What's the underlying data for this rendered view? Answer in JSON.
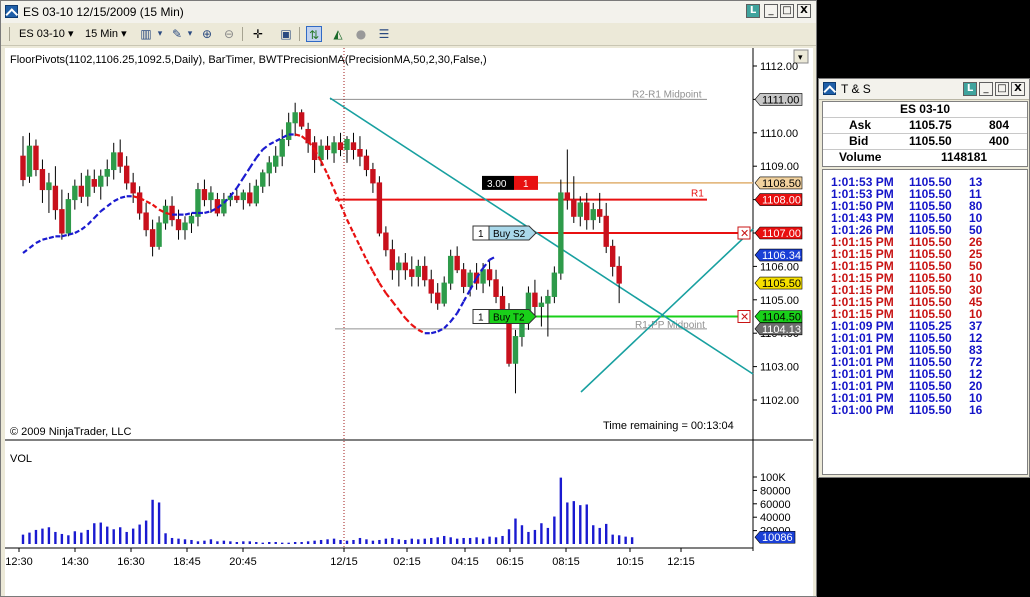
{
  "chart_window": {
    "title": "ES 03-10  12/15/2009 (15 Min)",
    "buttons": {
      "link": "L",
      "minimize": "_",
      "maximize": "□",
      "close": "X"
    },
    "toolbar": {
      "instrument": "ES 03-10",
      "interval": "15 Min"
    },
    "indicator_label": "FloorPivots(1102,1106.25,1092.5,Daily), BarTimer, BWTPrecisionMA(PrecisionMA,50,2,30,False,)",
    "copyright": "© 2009 NinjaTrader, LLC",
    "time_remaining": "Time remaining = 00:13:04",
    "volume_label": "VOL"
  },
  "chart_data": {
    "type": "candlestick",
    "price_axis": {
      "ylim": [
        1101.6,
        1112.2
      ],
      "ticks": [
        "1112.00",
        "1111.00",
        "1110.00",
        "1109.00",
        "1108.00",
        "1107.00",
        "1106.00",
        "1105.00",
        "1104.00",
        "1103.00",
        "1102.00"
      ]
    },
    "volume_axis": {
      "ylim": [
        0,
        100000
      ],
      "ticks": [
        "100K",
        "80000",
        "60000",
        "40000",
        "20000"
      ],
      "current": "10086"
    },
    "x_tick_labels": [
      "12:30",
      "14:30",
      "16:30",
      "18:45",
      "20:45",
      "12/15",
      "02:15",
      "04:15",
      "06:15",
      "08:15",
      "10:15",
      "12:15"
    ],
    "price_labels": [
      {
        "text": "1111.00",
        "price": 1111.0,
        "bg": "#c8c8c8",
        "fg": "#000000"
      },
      {
        "text": "1110.00",
        "price": 1110.0,
        "bg": "#ffffff",
        "fg": "#000000"
      },
      {
        "text": "1108.50",
        "price": 1108.5,
        "bg": "#f2d29e",
        "fg": "#000000"
      },
      {
        "text": "1108.00",
        "price": 1108.0,
        "bg": "#e81010",
        "fg": "#ffffff"
      },
      {
        "text": "1107.00",
        "price": 1107.0,
        "bg": "#e81010",
        "fg": "#ffffff"
      },
      {
        "text": "1106.34",
        "price": 1106.34,
        "bg": "#1a3fd6",
        "fg": "#ffffff"
      },
      {
        "text": "1105.50",
        "price": 1105.5,
        "bg": "#f6e000",
        "fg": "#000000"
      },
      {
        "text": "1104.50",
        "price": 1104.5,
        "bg": "#19d019",
        "fg": "#000000"
      },
      {
        "text": "1104.13",
        "price": 1104.13,
        "bg": "#6e6e6e",
        "fg": "#ffffff"
      }
    ],
    "levels": [
      {
        "name": "R2-R1 Midpoint",
        "price": 1111.0,
        "color": "#909090"
      },
      {
        "name": "R1",
        "price": 1108.0,
        "color": "#e81010"
      },
      {
        "name": "R1-PP Midpoint",
        "price": 1104.13,
        "color": "#909090"
      }
    ],
    "orders": [
      {
        "qty": "1",
        "label": "Buy S2",
        "price": 1107.0,
        "color": "#e81010"
      },
      {
        "qty": "1",
        "label": "Buy T2",
        "price": 1104.5,
        "color": "#19d019"
      },
      {
        "qty": "3.00",
        "label": "1",
        "price": 1108.5,
        "color": "#e0b070"
      }
    ],
    "colors": {
      "up_bar": "#2e9b4a",
      "down_bar": "#c8101c",
      "ma_up": "#1a1ad0",
      "ma_down": "#e81010",
      "trendline": "#18a0a0",
      "session_break": "#a01818",
      "volume": "#1a1ad0"
    },
    "bars": [
      [
        1109.3,
        1109.9,
        1108.4,
        1108.6
      ],
      [
        1108.7,
        1110.0,
        1108.5,
        1109.6
      ],
      [
        1109.6,
        1109.8,
        1108.7,
        1108.9
      ],
      [
        1108.9,
        1109.2,
        1107.9,
        1108.3
      ],
      [
        1108.3,
        1108.8,
        1107.6,
        1108.5
      ],
      [
        1108.4,
        1109.0,
        1107.4,
        1107.7
      ],
      [
        1107.7,
        1108.3,
        1106.8,
        1107.0
      ],
      [
        1107.0,
        1108.2,
        1106.9,
        1108.0
      ],
      [
        1108.0,
        1108.6,
        1107.7,
        1108.4
      ],
      [
        1108.4,
        1108.8,
        1107.9,
        1108.1
      ],
      [
        1108.1,
        1108.9,
        1107.8,
        1108.7
      ],
      [
        1108.6,
        1108.9,
        1108.2,
        1108.4
      ],
      [
        1108.4,
        1108.9,
        1108.0,
        1108.7
      ],
      [
        1108.7,
        1109.2,
        1108.4,
        1108.9
      ],
      [
        1108.9,
        1109.7,
        1108.6,
        1109.4
      ],
      [
        1109.4,
        1109.8,
        1108.8,
        1109.0
      ],
      [
        1109.0,
        1109.3,
        1108.3,
        1108.5
      ],
      [
        1108.5,
        1108.8,
        1107.9,
        1108.2
      ],
      [
        1108.2,
        1108.4,
        1107.4,
        1107.6
      ],
      [
        1107.6,
        1107.9,
        1106.9,
        1107.1
      ],
      [
        1107.1,
        1107.4,
        1106.3,
        1106.6
      ],
      [
        1106.6,
        1107.5,
        1106.5,
        1107.3
      ],
      [
        1107.3,
        1108.0,
        1107.1,
        1107.8
      ],
      [
        1107.8,
        1108.1,
        1107.2,
        1107.4
      ],
      [
        1107.4,
        1107.7,
        1106.8,
        1107.1
      ],
      [
        1107.1,
        1107.5,
        1106.8,
        1107.3
      ],
      [
        1107.3,
        1107.6,
        1107.0,
        1107.5
      ],
      [
        1107.5,
        1108.5,
        1107.2,
        1108.3
      ],
      [
        1108.3,
        1108.6,
        1107.8,
        1108.0
      ],
      [
        1108.0,
        1108.4,
        1107.6,
        1108.2
      ],
      [
        1108.0,
        1108.2,
        1107.5,
        1107.6
      ],
      [
        1107.6,
        1108.2,
        1107.5,
        1108.0
      ],
      [
        1108.0,
        1108.2,
        1107.8,
        1108.1
      ],
      [
        1108.1,
        1108.3,
        1107.9,
        1108.0
      ],
      [
        1108.0,
        1108.3,
        1107.7,
        1108.2
      ],
      [
        1108.2,
        1108.5,
        1107.8,
        1107.9
      ],
      [
        1107.9,
        1108.6,
        1107.8,
        1108.4
      ],
      [
        1108.4,
        1108.9,
        1108.2,
        1108.8
      ],
      [
        1108.8,
        1109.3,
        1108.4,
        1109.1
      ],
      [
        1109.0,
        1109.6,
        1108.8,
        1109.3
      ],
      [
        1109.3,
        1110.1,
        1109.0,
        1109.8
      ],
      [
        1109.8,
        1110.6,
        1109.6,
        1110.3
      ],
      [
        1110.3,
        1110.9,
        1109.9,
        1110.6
      ],
      [
        1110.6,
        1110.7,
        1110.1,
        1110.2
      ],
      [
        1110.1,
        1110.3,
        1109.4,
        1109.7
      ],
      [
        1109.7,
        1109.9,
        1108.8,
        1109.2
      ],
      [
        1109.2,
        1109.8,
        1109.0,
        1109.6
      ],
      [
        1109.6,
        1109.9,
        1109.2,
        1109.5
      ],
      [
        1109.4,
        1109.9,
        1109.1,
        1109.7
      ],
      [
        1109.7,
        1110.0,
        1109.3,
        1109.5
      ],
      [
        1109.5,
        1109.9,
        1109.1,
        1109.8
      ],
      [
        1109.7,
        1110.0,
        1109.2,
        1109.5
      ],
      [
        1109.5,
        1109.9,
        1109.0,
        1109.3
      ],
      [
        1109.3,
        1109.5,
        1108.7,
        1108.9
      ],
      [
        1108.9,
        1109.1,
        1108.2,
        1108.5
      ],
      [
        1108.5,
        1108.7,
        1106.9,
        1107.0
      ],
      [
        1107.0,
        1107.2,
        1106.3,
        1106.5
      ],
      [
        1106.5,
        1106.8,
        1105.6,
        1105.9
      ],
      [
        1105.9,
        1106.3,
        1105.4,
        1106.1
      ],
      [
        1106.1,
        1106.4,
        1105.6,
        1105.9
      ],
      [
        1105.9,
        1106.3,
        1105.4,
        1105.7
      ],
      [
        1105.7,
        1106.2,
        1105.4,
        1106.0
      ],
      [
        1106.0,
        1106.3,
        1105.4,
        1105.6
      ],
      [
        1105.6,
        1105.9,
        1104.9,
        1105.2
      ],
      [
        1105.2,
        1105.5,
        1104.7,
        1104.9
      ],
      [
        1104.9,
        1105.7,
        1104.8,
        1105.5
      ],
      [
        1105.5,
        1106.5,
        1105.3,
        1106.3
      ],
      [
        1106.3,
        1106.6,
        1105.8,
        1105.9
      ],
      [
        1105.9,
        1106.1,
        1105.2,
        1105.4
      ],
      [
        1105.4,
        1105.9,
        1105.1,
        1105.8
      ],
      [
        1105.8,
        1106.1,
        1105.3,
        1105.5
      ],
      [
        1105.5,
        1106.1,
        1105.2,
        1105.9
      ],
      [
        1105.9,
        1106.2,
        1105.4,
        1105.6
      ],
      [
        1105.6,
        1105.9,
        1104.9,
        1105.1
      ],
      [
        1105.1,
        1105.4,
        1104.4,
        1104.7
      ],
      [
        1104.7,
        1104.9,
        1103.0,
        1103.1
      ],
      [
        1103.1,
        1104.1,
        1102.2,
        1103.9
      ],
      [
        1103.9,
        1104.6,
        1103.6,
        1104.4
      ],
      [
        1104.4,
        1105.4,
        1104.1,
        1105.2
      ],
      [
        1105.2,
        1105.6,
        1104.5,
        1104.8
      ],
      [
        1104.8,
        1105.1,
        1104.2,
        1104.9
      ],
      [
        1104.9,
        1105.3,
        1103.9,
        1105.1
      ],
      [
        1105.1,
        1106.0,
        1104.9,
        1105.8
      ],
      [
        1105.8,
        1108.6,
        1105.6,
        1108.2
      ],
      [
        1108.2,
        1109.5,
        1107.7,
        1108.0
      ],
      [
        1108.0,
        1108.7,
        1107.3,
        1107.5
      ],
      [
        1107.5,
        1108.1,
        1107.2,
        1107.9
      ],
      [
        1107.9,
        1108.2,
        1107.1,
        1107.4
      ],
      [
        1107.4,
        1107.9,
        1107.1,
        1107.7
      ],
      [
        1107.7,
        1108.2,
        1107.3,
        1107.5
      ],
      [
        1107.5,
        1107.9,
        1106.4,
        1106.6
      ],
      [
        1106.6,
        1106.8,
        1105.7,
        1106.0
      ],
      [
        1106.0,
        1106.3,
        1104.9,
        1105.5
      ]
    ],
    "ma": [
      1106.4,
      1106.55,
      1106.7,
      1106.8,
      1106.85,
      1106.9,
      1106.9,
      1106.95,
      1107.0,
      1107.1,
      1107.25,
      1107.45,
      1107.65,
      1107.8,
      1107.95,
      1108.05,
      1108.1,
      1108.1,
      1108.05,
      1107.95,
      1107.85,
      1107.7,
      1107.6,
      1107.55,
      1107.55,
      1107.55,
      1107.6,
      1107.6,
      1107.6,
      1107.65,
      1107.75,
      1107.9,
      1108.1,
      1108.35,
      1108.65,
      1108.95,
      1109.25,
      1109.5,
      1109.65,
      1109.75,
      1109.85,
      1109.95,
      1109.95,
      1109.9,
      1109.75,
      1109.5,
      1109.15,
      1108.75,
      1108.3,
      1107.85,
      1107.4,
      1107.0,
      1106.6,
      1106.2,
      1105.85,
      1105.5,
      1105.2,
      1104.95,
      1104.7,
      1104.45,
      1104.25,
      1104.1,
      1104.0,
      1104.0,
      1104.05,
      1104.15,
      1104.35,
      1104.6,
      1104.95,
      1105.3,
      1105.65,
      1105.95,
      1106.2,
      1106.3
    ],
    "ma_start": 0,
    "volume": [
      14000,
      17000,
      21000,
      23000,
      25000,
      18000,
      15000,
      13000,
      19000,
      17000,
      21000,
      31000,
      32000,
      26000,
      22000,
      25000,
      18000,
      23000,
      29000,
      35000,
      66000,
      62000,
      16000,
      9000,
      8000,
      7000,
      6000,
      4000,
      5000,
      7000,
      4000,
      5000,
      4000,
      3000,
      4000,
      4000,
      3000,
      2000,
      3000,
      3000,
      2000,
      2000,
      3000,
      3000,
      4000,
      5000,
      6000,
      7000,
      8000,
      6000,
      5000,
      6000,
      9000,
      7000,
      5000,
      6000,
      8000,
      9000,
      7000,
      6000,
      8000,
      7000,
      8000,
      9000,
      10000,
      12000,
      10000,
      8000,
      9000,
      9000,
      10000,
      8000,
      11000,
      10000,
      12000,
      22000,
      38000,
      28000,
      18000,
      21000,
      31000,
      24000,
      41000,
      99000,
      62000,
      64000,
      58000,
      59000,
      28000,
      24000,
      30000,
      14000,
      13000,
      11000,
      10086
    ]
  },
  "ts_window": {
    "title": "T & S",
    "instrument": "ES 03-10",
    "buttons": {
      "link": "L",
      "minimize": "_",
      "maximize": "□",
      "close": "X"
    },
    "ask": {
      "label": "Ask",
      "price": "1105.75",
      "size": "804"
    },
    "bid": {
      "label": "Bid",
      "price": "1105.50",
      "size": "400"
    },
    "volume": {
      "label": "Volume",
      "value": "1148181"
    },
    "trades": [
      {
        "time": "1:01:53 PM",
        "price": "1105.50",
        "size": "13",
        "color": "#1414c8"
      },
      {
        "time": "1:01:53 PM",
        "price": "1105.50",
        "size": "11",
        "color": "#1414c8"
      },
      {
        "time": "1:01:50 PM",
        "price": "1105.50",
        "size": "80",
        "color": "#1414c8"
      },
      {
        "time": "1:01:43 PM",
        "price": "1105.50",
        "size": "10",
        "color": "#1414c8"
      },
      {
        "time": "1:01:26 PM",
        "price": "1105.50",
        "size": "50",
        "color": "#1414c8"
      },
      {
        "time": "1:01:15 PM",
        "price": "1105.50",
        "size": "26",
        "color": "#c81414"
      },
      {
        "time": "1:01:15 PM",
        "price": "1105.50",
        "size": "25",
        "color": "#c81414"
      },
      {
        "time": "1:01:15 PM",
        "price": "1105.50",
        "size": "50",
        "color": "#c81414"
      },
      {
        "time": "1:01:15 PM",
        "price": "1105.50",
        "size": "10",
        "color": "#c81414"
      },
      {
        "time": "1:01:15 PM",
        "price": "1105.50",
        "size": "30",
        "color": "#c81414"
      },
      {
        "time": "1:01:15 PM",
        "price": "1105.50",
        "size": "45",
        "color": "#c81414"
      },
      {
        "time": "1:01:15 PM",
        "price": "1105.50",
        "size": "10",
        "color": "#c81414"
      },
      {
        "time": "1:01:09 PM",
        "price": "1105.25",
        "size": "37",
        "color": "#1414c8"
      },
      {
        "time": "1:01:01 PM",
        "price": "1105.50",
        "size": "12",
        "color": "#1414c8"
      },
      {
        "time": "1:01:01 PM",
        "price": "1105.50",
        "size": "83",
        "color": "#1414c8"
      },
      {
        "time": "1:01:01 PM",
        "price": "1105.50",
        "size": "72",
        "color": "#1414c8"
      },
      {
        "time": "1:01:01 PM",
        "price": "1105.50",
        "size": "12",
        "color": "#1414c8"
      },
      {
        "time": "1:01:01 PM",
        "price": "1105.50",
        "size": "20",
        "color": "#1414c8"
      },
      {
        "time": "1:01:01 PM",
        "price": "1105.50",
        "size": "10",
        "color": "#1414c8"
      },
      {
        "time": "1:01:00 PM",
        "price": "1105.50",
        "size": "16",
        "color": "#1414c8"
      }
    ]
  }
}
